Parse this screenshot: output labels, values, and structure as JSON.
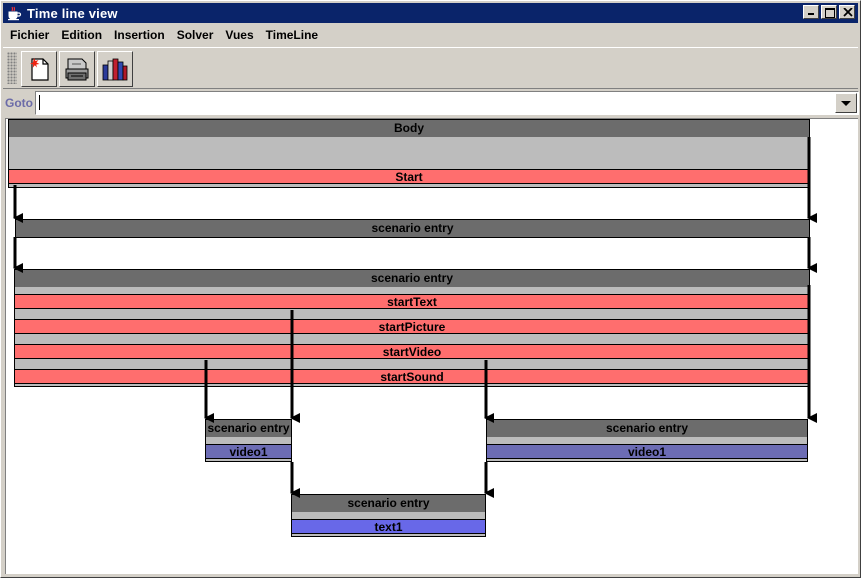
{
  "window": {
    "title": "Time line view"
  },
  "menu": [
    "Fichier",
    "Edition",
    "Insertion",
    "Solver",
    "Vues",
    "TimeLine"
  ],
  "toolbar": {
    "icons": [
      "new-document-icon",
      "printer-icon",
      "library-books-icon"
    ]
  },
  "goto": {
    "label": "Goto",
    "value": ""
  },
  "timeline": {
    "body": {
      "header": "Body",
      "start": "Start"
    },
    "scenario_entry_1": {
      "header": "scenario entry"
    },
    "scenario_entry_2": {
      "header": "scenario entry",
      "events": [
        "startText",
        "startPicture",
        "startVideo",
        "startSound"
      ]
    },
    "scenario_video_left": {
      "header": "scenario entry",
      "media": "video1"
    },
    "scenario_video_right": {
      "header": "scenario entry",
      "media": "video1"
    },
    "scenario_text": {
      "header": "scenario entry",
      "media": "text1"
    }
  },
  "colors": {
    "header_gray": "#6c6c6c",
    "event_red": "#ff6e6e",
    "video_blue": "#6c6cb4",
    "text_blue": "#6868e8",
    "titlebar_blue": "#0a246a"
  }
}
